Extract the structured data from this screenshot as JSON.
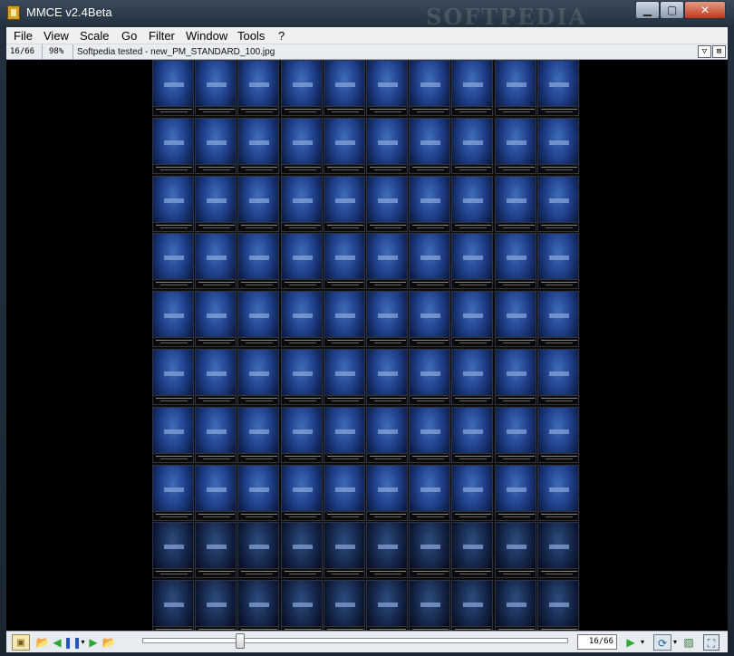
{
  "window": {
    "title": "MMCE v2.4Beta",
    "watermark": "SOFTPEDIA"
  },
  "controls": {
    "minimize": "▁",
    "maximize": "▢",
    "close": "✕"
  },
  "menu": {
    "file": "File",
    "view": "View",
    "scale": "Scale",
    "go": "Go",
    "filter": "Filter",
    "window": "Window",
    "tools": "Tools",
    "help": "?"
  },
  "infobar": {
    "counter": "16/66",
    "zoom": "98%",
    "filename": "Softpedia tested - new_PM_STANDARD_100.jpg",
    "dropdown_icon": "▽",
    "close_icon": "⊠"
  },
  "contact_sheet": {
    "rows": 10,
    "columns": 10
  },
  "bottombar": {
    "fit_icon": "▣",
    "open_icon": "📂",
    "prev_icon": "◀",
    "pause_icon": "❚❚",
    "more_icon": "▾",
    "next_icon": "▶",
    "open_b_icon": "📂",
    "slider_position": 0.22,
    "page_value": "16/66",
    "play_icon": "▶",
    "play_more_icon": "▾",
    "rotate_icon": "⟳",
    "rotate_more_icon": "▾",
    "image_icon": "▨",
    "fullscreen_icon": "⛶"
  }
}
